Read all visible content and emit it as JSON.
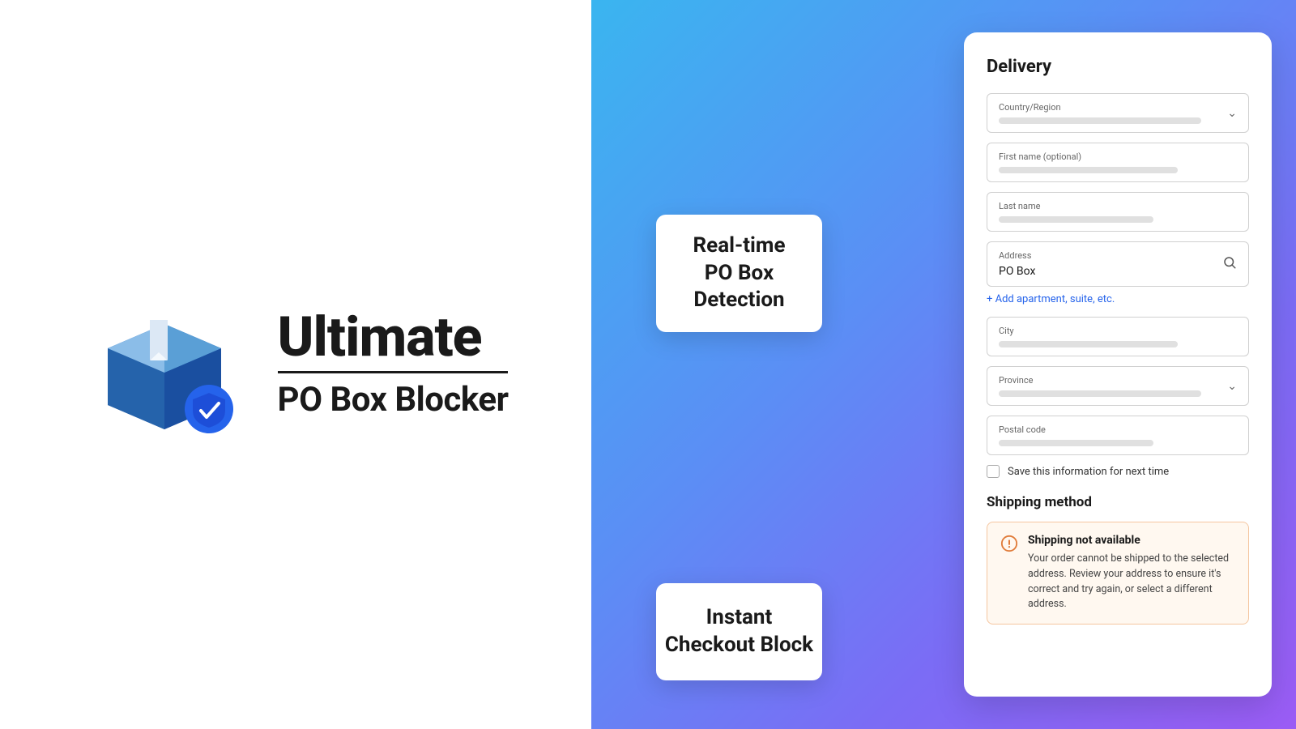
{
  "brand": {
    "title": "Ultimate",
    "subtitle": "PO Box Blocker"
  },
  "cards": {
    "realtime": {
      "line1": "Real-time",
      "line2": "PO Box",
      "line3": "Detection"
    },
    "instant": {
      "line1": "Instant",
      "line2": "Checkout Block"
    }
  },
  "form": {
    "delivery_title": "Delivery",
    "fields": {
      "country_label": "Country/Region",
      "first_name_label": "First name (optional)",
      "last_name_label": "Last name",
      "address_label": "Address",
      "address_value": "PO Box",
      "add_apartment": "+ Add apartment, suite, etc.",
      "city_label": "City",
      "province_label": "Province",
      "postal_label": "Postal code",
      "save_label": "Save this information for next time"
    },
    "shipping_method_title": "Shipping method",
    "shipping_unavailable_title": "Shipping not available",
    "shipping_unavailable_text": "Your order cannot be shipped to the selected address. Review your address to ensure it's correct and try again, or select a different address."
  }
}
